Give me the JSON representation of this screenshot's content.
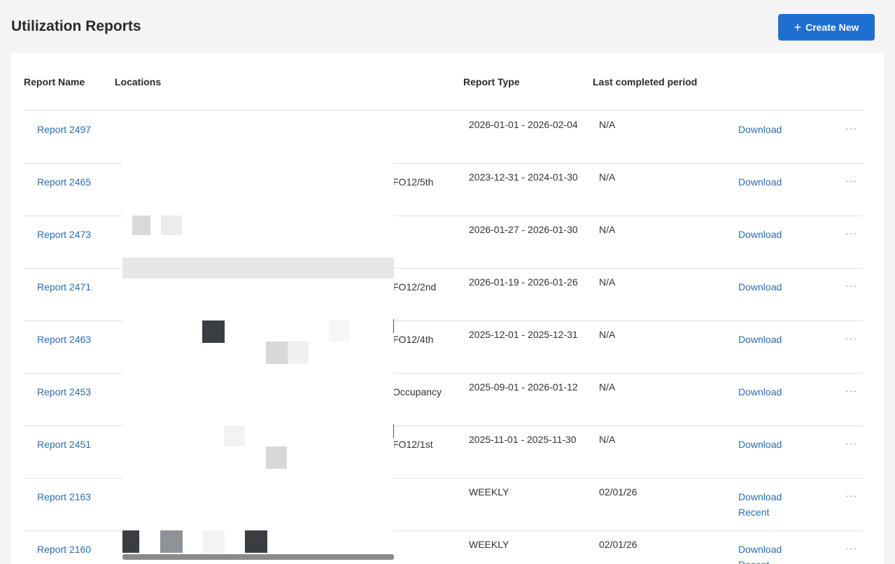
{
  "page": {
    "title": "Utilization Reports",
    "create_label": "Create New"
  },
  "table": {
    "headers": {
      "report_name": "Report Name",
      "locations": "Locations",
      "report_type": "Report Type",
      "last_completed": "Last completed period"
    },
    "rows": [
      {
        "name": "Report 2497",
        "location": "",
        "type": "2026-01-01 - 2026-02-04",
        "last": "N/A",
        "download": "Download"
      },
      {
        "name": "Report 2465",
        "location": "FO12/5th",
        "type": "2023-12-31 - 2024-01-30",
        "last": "N/A",
        "download": "Download"
      },
      {
        "name": "Report 2473",
        "location": "",
        "type": "2026-01-27 - 2026-01-30",
        "last": "N/A",
        "download": "Download"
      },
      {
        "name": "Report 2471",
        "location": "FO12/2nd",
        "type": "2026-01-19 - 2026-01-26",
        "last": "N/A",
        "download": "Download"
      },
      {
        "name": "Report 2463",
        "location": "FO12/4th",
        "type": "2025-12-01 - 2025-12-31",
        "last": "N/A",
        "download": "Download"
      },
      {
        "name": "Report 2453",
        "location": "Occupancy",
        "type": "2025-09-01 - 2026-01-12",
        "last": "N/A",
        "download": "Download"
      },
      {
        "name": "Report 2451",
        "location": "FO12/1st",
        "type": "2025-11-01 - 2025-11-30",
        "last": "N/A",
        "download": "Download"
      },
      {
        "name": "Report 2163",
        "location": "",
        "type": "WEEKLY",
        "last": "02/01/26",
        "download": "Download Recent"
      },
      {
        "name": "Report 2160",
        "location": "",
        "type": "WEEKLY",
        "last": "02/01/26",
        "download": "Download Recent"
      }
    ]
  },
  "icons": {
    "create": "plus-icon",
    "more": "more-options-icon"
  },
  "colors": {
    "accent": "#1f6fd1",
    "link": "#2b6cb0"
  }
}
